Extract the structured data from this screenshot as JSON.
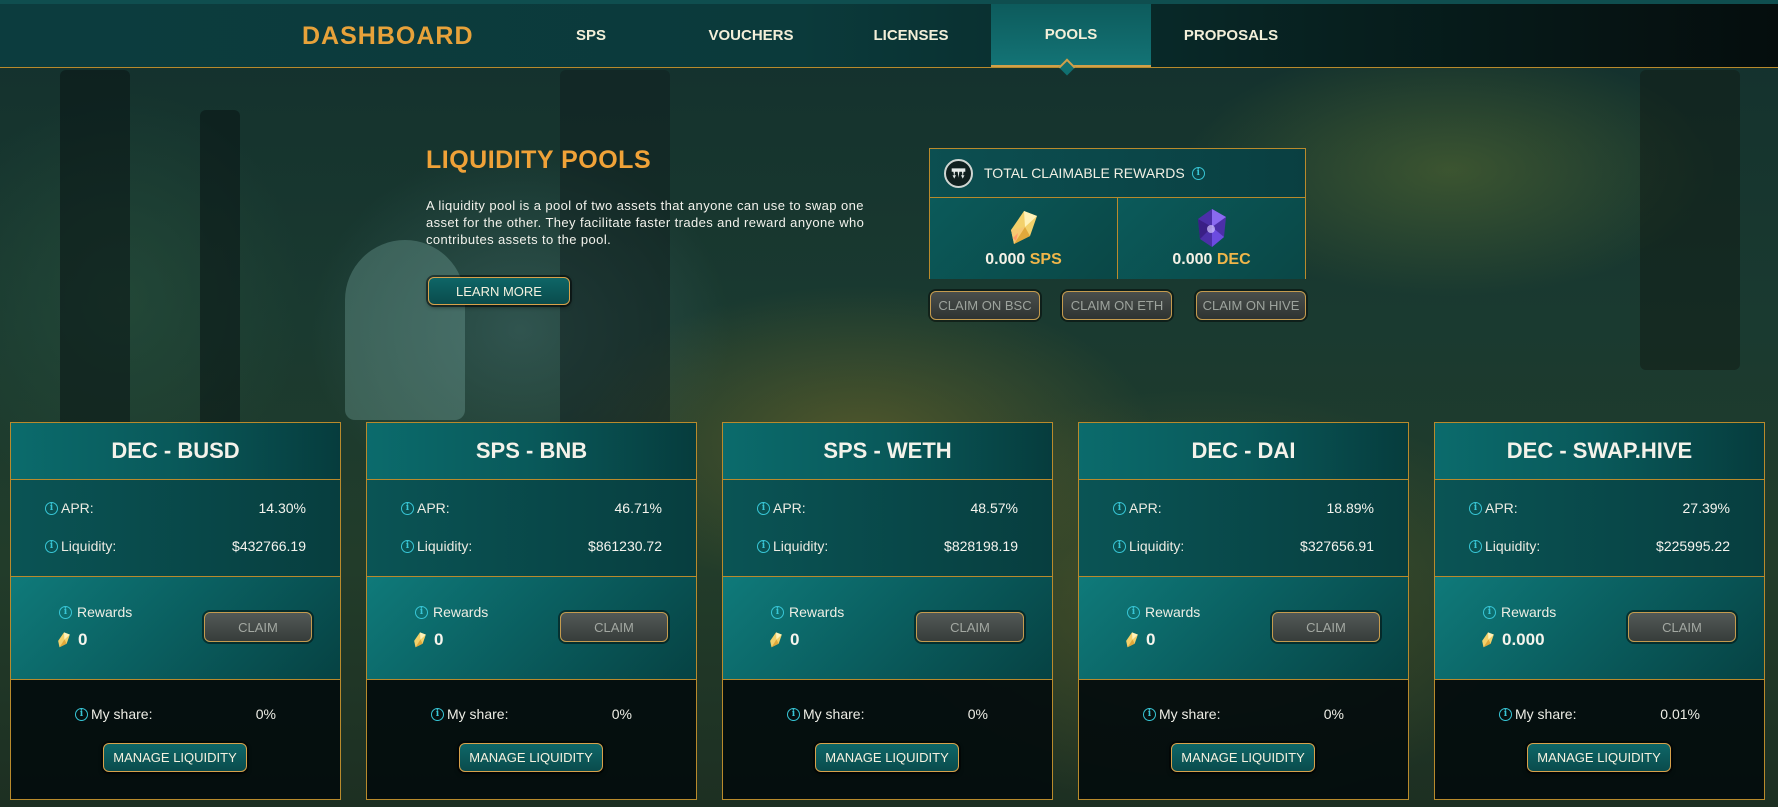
{
  "nav": {
    "brand": "DASHBOARD",
    "tabs": [
      {
        "label": "SPS"
      },
      {
        "label": "VOUCHERS"
      },
      {
        "label": "LICENSES"
      },
      {
        "label": "POOLS",
        "active": true
      },
      {
        "label": "PROPOSALS"
      }
    ]
  },
  "hero": {
    "title": "LIQUIDITY POOLS",
    "description": "A liquidity pool is a pool of two assets that anyone can use to swap one asset for the other. They facilitate faster trades and reward anyone who contributes assets to the pool.",
    "learn_more": "LEARN MORE"
  },
  "rewards": {
    "title": "TOTAL CLAIMABLE REWARDS",
    "sps_amount": "0.000",
    "sps_unit": "SPS",
    "dec_amount": "0.000",
    "dec_unit": "DEC",
    "claim_bsc": "CLAIM ON BSC",
    "claim_eth": "CLAIM ON ETH",
    "claim_hive": "CLAIM ON HIVE"
  },
  "labels": {
    "apr": "APR:",
    "liquidity": "Liquidity:",
    "rewards": "Rewards",
    "claim": "CLAIM",
    "my_share": "My share:",
    "manage": "MANAGE LIQUIDITY"
  },
  "pools": [
    {
      "name": "DEC - BUSD",
      "apr": "14.30%",
      "liquidity": "$432766.19",
      "rewards": "0",
      "share": "0%"
    },
    {
      "name": "SPS - BNB",
      "apr": "46.71%",
      "liquidity": "$861230.72",
      "rewards": "0",
      "share": "0%"
    },
    {
      "name": "SPS - WETH",
      "apr": "48.57%",
      "liquidity": "$828198.19",
      "rewards": "0",
      "share": "0%"
    },
    {
      "name": "DEC - DAI",
      "apr": "18.89%",
      "liquidity": "$327656.91",
      "rewards": "0",
      "share": "0%"
    },
    {
      "name": "DEC - SWAP.HIVE",
      "apr": "27.39%",
      "liquidity": "$225995.22",
      "rewards": "0.000",
      "share": "0.01%"
    }
  ],
  "colors": {
    "accent_gold": "#e8a23a",
    "border_gold": "#b98a2c",
    "teal": "#0b6b6c",
    "info_cyan": "#38c6d6"
  }
}
